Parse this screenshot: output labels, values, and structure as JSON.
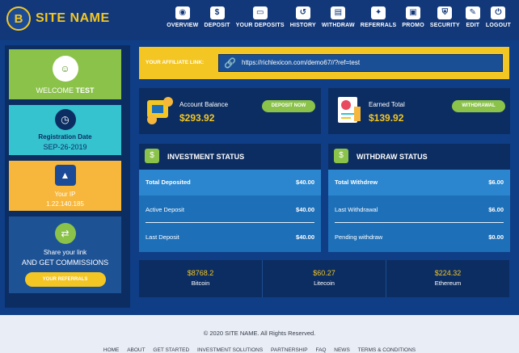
{
  "brand": {
    "logo_letter": "B",
    "name": "SITE NAME"
  },
  "nav": [
    {
      "label": "OVERVIEW",
      "icon": "eye-icon",
      "glyph": "◉"
    },
    {
      "label": "DEPOSIT",
      "icon": "money-bag-icon",
      "glyph": "$"
    },
    {
      "label": "YOUR DEPOSITS",
      "icon": "cash-icon",
      "glyph": "▭"
    },
    {
      "label": "HISTORY",
      "icon": "history-icon",
      "glyph": "↺"
    },
    {
      "label": "WITHDRAW",
      "icon": "wallet-icon",
      "glyph": "▤"
    },
    {
      "label": "REFERRALS",
      "icon": "referrals-icon",
      "glyph": "✦"
    },
    {
      "label": "PROMO",
      "icon": "promo-icon",
      "glyph": "▣"
    },
    {
      "label": "SECURITY",
      "icon": "shield-icon",
      "glyph": "⛨"
    },
    {
      "label": "EDIT",
      "icon": "edit-icon",
      "glyph": "✎"
    },
    {
      "label": "LOGOUT",
      "icon": "power-icon",
      "glyph": "⏻"
    }
  ],
  "sidebar": {
    "welcome": {
      "prefix": "WELCOME",
      "name": "TEST",
      "icon": "user-avatar-icon"
    },
    "registration": {
      "label": "Registration Date",
      "value": "SEP-26-2019",
      "icon": "clock-icon"
    },
    "ip": {
      "label": "Your IP",
      "value": "1.22.140.185",
      "icon": "ip-icon"
    },
    "share": {
      "line1": "Share your link",
      "line2": "AND GET COMMISSIONS",
      "button": "YOUR REFERRALS",
      "icon": "share-icon"
    }
  },
  "affiliate": {
    "label": "YOUR AFFILIATE LINK:",
    "url": "https://richlexicon.com/demo67//?ref=test",
    "icon": "link-icon"
  },
  "balance": {
    "account": {
      "title": "Account Balance",
      "amount": "$293.92",
      "button": "DEPOSIT NOW"
    },
    "earned": {
      "title": "Earned Total",
      "amount": "$139.92",
      "button": "WITHDRAWAL"
    }
  },
  "investment": {
    "title": "INVESTMENT STATUS",
    "rows": [
      {
        "label": "Total Deposited",
        "value": "$40.00"
      },
      {
        "label": "Active Deposit",
        "value": "$40.00"
      },
      {
        "label": "Last Deposit",
        "value": "$40.00"
      }
    ]
  },
  "withdraw": {
    "title": "WITHDRAW STATUS",
    "rows": [
      {
        "label": "Total Withdrew",
        "value": "$6.00"
      },
      {
        "label": "Last Withdrawal",
        "value": "$6.00"
      },
      {
        "label": "Pending withdraw",
        "value": "$0.00"
      }
    ]
  },
  "crypto": [
    {
      "value": "$8768.2",
      "name": "Bitcoin"
    },
    {
      "value": "$60.27",
      "name": "Litecoin"
    },
    {
      "value": "$224.32",
      "name": "Ethereum"
    }
  ],
  "footer": {
    "copyright": "© 2020 SITE NAME. All Rights Reserved.",
    "links": [
      "HOME",
      "ABOUT",
      "GET STARTED",
      "INVESTMENT SOLUTIONS",
      "PARTNERSHIP",
      "FAQ",
      "NEWS",
      "TERMS & CONDITIONS"
    ]
  },
  "colors": {
    "primary": "#12387a",
    "accent": "#f3c623",
    "green": "#8bc34a",
    "cyan": "#35c3d0",
    "orange": "#f6b73c"
  }
}
